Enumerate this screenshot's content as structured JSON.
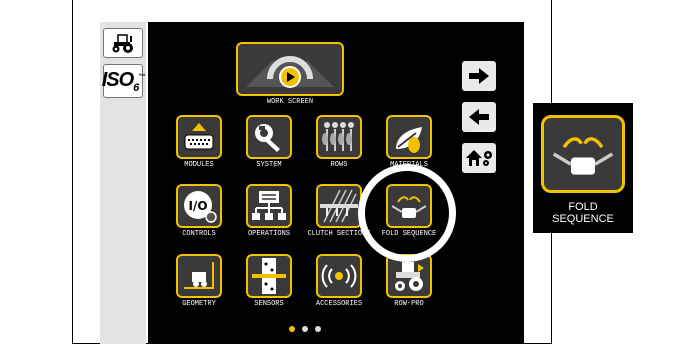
{
  "work_screen": {
    "label": "WORK SCREEN"
  },
  "tiles": [
    {
      "label": "MODULES"
    },
    {
      "label": "SYSTEM"
    },
    {
      "label": "ROWS"
    },
    {
      "label": "MATERIALS"
    },
    {
      "label": "CONTROLS"
    },
    {
      "label": "OPERATIONS"
    },
    {
      "label": "CLUTCH SECTIONS"
    },
    {
      "label": "FOLD SEQUENCE"
    },
    {
      "label": "GEOMETRY"
    },
    {
      "label": "SENSORS"
    },
    {
      "label": "ACCESSORIES"
    },
    {
      "label": "ROW-PRO"
    }
  ],
  "iso": {
    "text": "ISO",
    "sub": "6",
    "sup": "™"
  },
  "zoom": {
    "label_line1": "FOLD",
    "label_line2": "SEQUENCE"
  },
  "page_dots": {
    "count": 3,
    "active": 1
  },
  "colors": {
    "accent": "#f2c200",
    "screen_bg": "#000000",
    "tile_bg": "#3a3a3a"
  }
}
